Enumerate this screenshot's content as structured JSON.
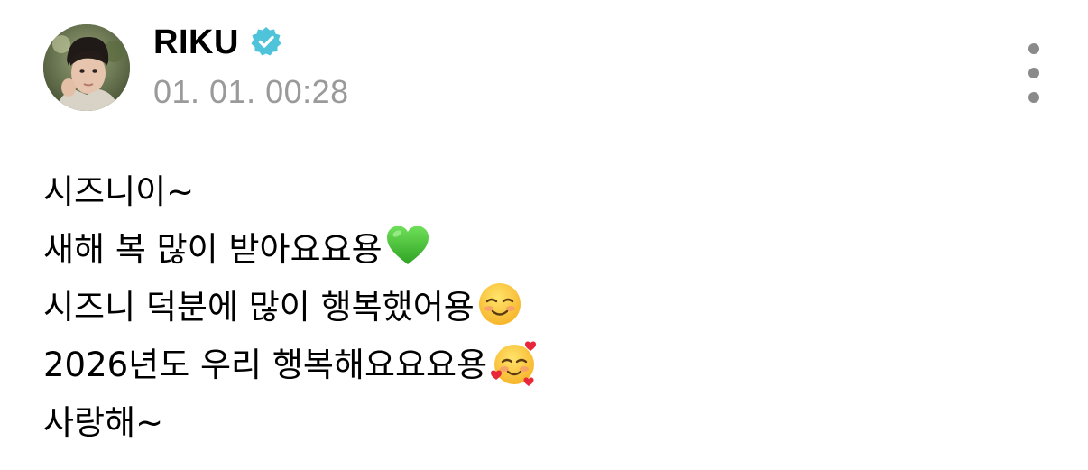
{
  "author": {
    "name": "RIKU",
    "verified": true,
    "avatar_icon": "profile-photo",
    "timestamp": "01. 01. 00:28"
  },
  "menu": {
    "icon": "more-vertical-icon"
  },
  "post": {
    "lines": [
      {
        "text": "시즈니이~",
        "emoji": null
      },
      {
        "text": "새해 복 많이 받아요요용",
        "emoji": "green-heart-icon"
      },
      {
        "text": "시즈니 덕분에 많이 행복했어용",
        "emoji": "smiling-face-icon"
      },
      {
        "text": "2026년도 우리 행복해요요요용",
        "emoji": "smiling-face-with-hearts-icon"
      },
      {
        "text": "사랑해~",
        "emoji": null
      }
    ]
  },
  "colors": {
    "verified_badge": "#4fc3d9",
    "timestamp": "#9a9a9a",
    "menu_dots": "#8a8a8a",
    "text": "#000000"
  }
}
